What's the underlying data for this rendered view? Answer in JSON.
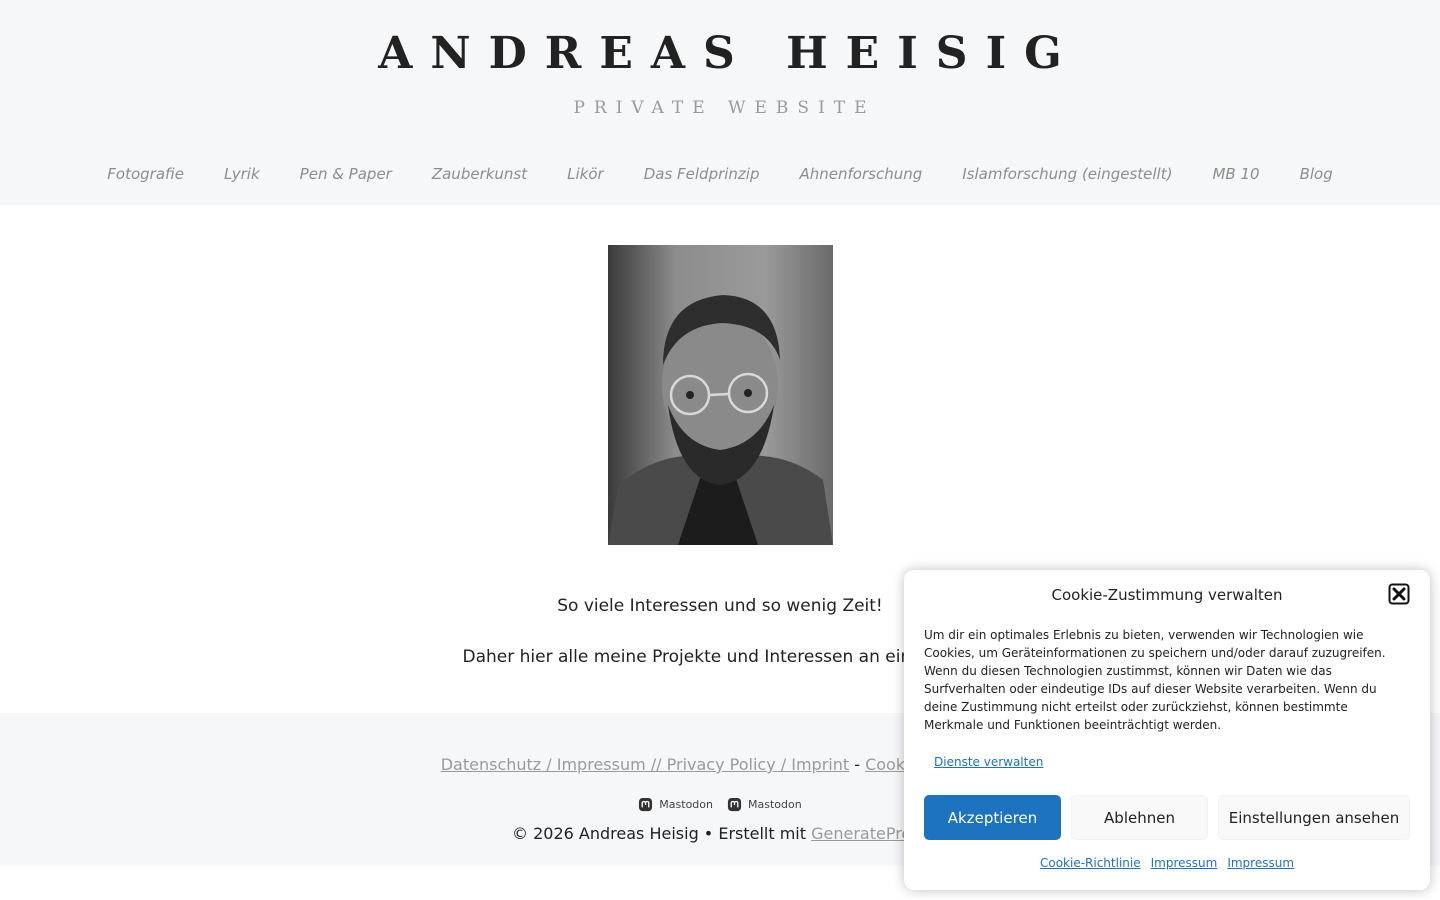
{
  "header": {
    "title": "ANDREAS HEISIG",
    "tagline": "PRIVATE WEBSITE"
  },
  "nav": {
    "items": [
      {
        "label": "Fotografie"
      },
      {
        "label": "Lyrik"
      },
      {
        "label": "Pen & Paper"
      },
      {
        "label": "Zauberkunst"
      },
      {
        "label": "Likör"
      },
      {
        "label": "Das Feldprinzip"
      },
      {
        "label": "Ahnenforschung"
      },
      {
        "label": "Islamforschung (eingestellt)"
      },
      {
        "label": "MB 10"
      },
      {
        "label": "Blog"
      }
    ]
  },
  "content": {
    "line1": "So viele Interessen und so wenig Zeit!",
    "line2": "Daher hier alle meine Projekte und Interessen an einem Ort!"
  },
  "footer": {
    "privacy_link": "Datenschutz / Impressum // Privacy Policy / Imprint",
    "separator": " - ",
    "cookie_link": "Cookie-Richtlinie",
    "social": [
      {
        "label": "Mastodon",
        "icon": "mastodon-icon"
      },
      {
        "label": "Mastodon",
        "icon": "mastodon-icon"
      }
    ],
    "copyright_prefix": "© 2026 Andreas Heisig • Erstellt mit ",
    "copyright_link": "GeneratePress"
  },
  "cookie": {
    "title": "Cookie-Zustimmung verwalten",
    "text": "Um dir ein optimales Erlebnis zu bieten, verwenden wir Technologien wie Cookies, um Geräteinformationen zu speichern und/oder darauf zuzugreifen. Wenn du diesen Technologien zustimmst, können wir Daten wie das Surfverhalten oder eindeutige IDs auf dieser Website verarbeiten. Wenn du deine Zustimmung nicht erteilst oder zurückziehst, können bestimmte Merkmale und Funktionen beeinträchtigt werden.",
    "manage_label": "Dienste verwalten",
    "accept_label": "Akzeptieren",
    "deny_label": "Ablehnen",
    "prefs_label": "Einstellungen ansehen",
    "links": [
      "Cookie-Richtlinie",
      "Impressum",
      "Impressum"
    ],
    "accent_color": "#1e73be"
  }
}
